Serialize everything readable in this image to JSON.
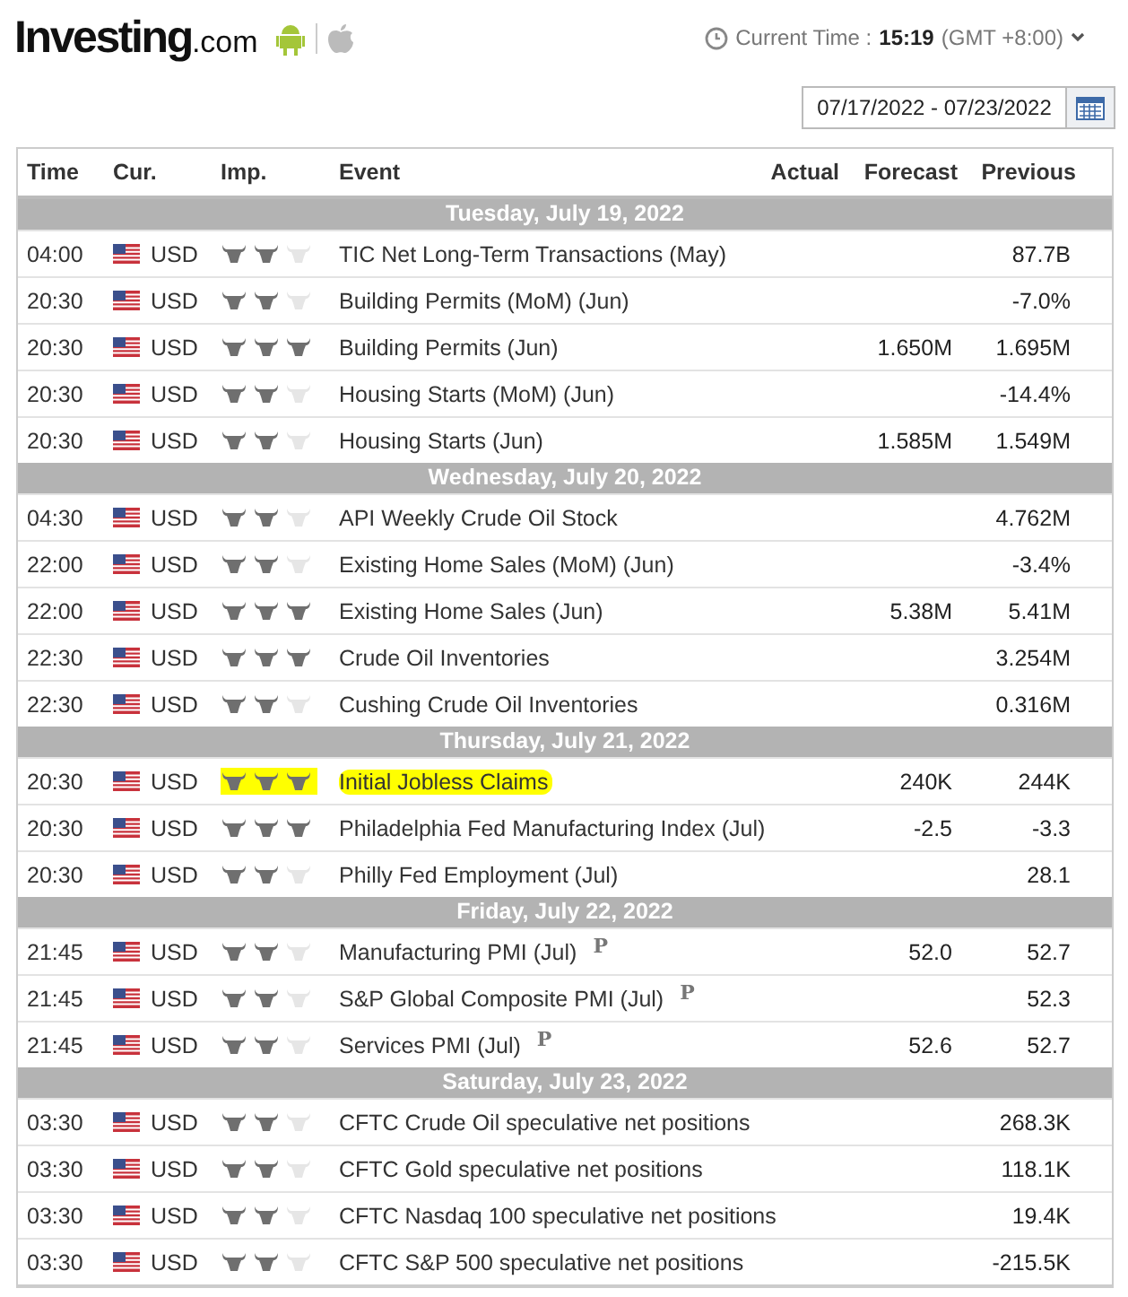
{
  "header": {
    "logo": "Investing",
    "logo_suffix": ".com",
    "current_time_label": "Current Time :",
    "current_time": "15:19",
    "timezone": "(GMT +8:00)"
  },
  "date_range": {
    "value": "07/17/2022 - 07/23/2022"
  },
  "table": {
    "columns": [
      "Time",
      "Cur.",
      "Imp.",
      "Event",
      "Actual",
      "Forecast",
      "Previous"
    ],
    "days": [
      {
        "label": "Tuesday, July 19, 2022",
        "rows": [
          {
            "time": "04:00",
            "currency": "USD",
            "stars": 2,
            "event": "TIC Net Long-Term Transactions (May)",
            "actual": "",
            "forecast": "",
            "previous": "87.7B",
            "highlighted": false
          },
          {
            "time": "20:30",
            "currency": "USD",
            "stars": 2,
            "event": "Building Permits (MoM) (Jun)",
            "actual": "",
            "forecast": "",
            "previous": "-7.0%",
            "highlighted": false
          },
          {
            "time": "20:30",
            "currency": "USD",
            "stars": 3,
            "event": "Building Permits (Jun)",
            "actual": "",
            "forecast": "1.650M",
            "previous": "1.695M",
            "highlighted": false
          },
          {
            "time": "20:30",
            "currency": "USD",
            "stars": 2,
            "event": "Housing Starts (MoM) (Jun)",
            "actual": "",
            "forecast": "",
            "previous": "-14.4%",
            "highlighted": false
          },
          {
            "time": "20:30",
            "currency": "USD",
            "stars": 2,
            "event": "Housing Starts (Jun)",
            "actual": "",
            "forecast": "1.585M",
            "previous": "1.549M",
            "highlighted": false
          }
        ]
      },
      {
        "label": "Wednesday, July 20, 2022",
        "rows": [
          {
            "time": "04:30",
            "currency": "USD",
            "stars": 2,
            "event": "API Weekly Crude Oil Stock",
            "actual": "",
            "forecast": "",
            "previous": "4.762M",
            "highlighted": false
          },
          {
            "time": "22:00",
            "currency": "USD",
            "stars": 2,
            "event": "Existing Home Sales (MoM) (Jun)",
            "actual": "",
            "forecast": "",
            "previous": "-3.4%",
            "highlighted": false
          },
          {
            "time": "22:00",
            "currency": "USD",
            "stars": 3,
            "event": "Existing Home Sales (Jun)",
            "actual": "",
            "forecast": "5.38M",
            "previous": "5.41M",
            "highlighted": false
          },
          {
            "time": "22:30",
            "currency": "USD",
            "stars": 3,
            "event": "Crude Oil Inventories",
            "actual": "",
            "forecast": "",
            "previous": "3.254M",
            "highlighted": false
          },
          {
            "time": "22:30",
            "currency": "USD",
            "stars": 2,
            "event": "Cushing Crude Oil Inventories",
            "actual": "",
            "forecast": "",
            "previous": "0.316M",
            "highlighted": false
          }
        ]
      },
      {
        "label": "Thursday, July 21, 2022",
        "rows": [
          {
            "time": "20:30",
            "currency": "USD",
            "stars": 3,
            "event": "Initial Jobless Claims",
            "actual": "",
            "forecast": "240K",
            "previous": "244K",
            "highlighted": true
          },
          {
            "time": "20:30",
            "currency": "USD",
            "stars": 3,
            "event": "Philadelphia Fed Manufacturing Index (Jul)",
            "actual": "",
            "forecast": "-2.5",
            "previous": "-3.3",
            "highlighted": false
          },
          {
            "time": "20:30",
            "currency": "USD",
            "stars": 2,
            "event": "Philly Fed Employment (Jul)",
            "actual": "",
            "forecast": "",
            "previous": "28.1",
            "highlighted": false
          }
        ]
      },
      {
        "label": "Friday, July 22, 2022",
        "rows": [
          {
            "time": "21:45",
            "currency": "USD",
            "stars": 2,
            "event": "Manufacturing PMI (Jul)",
            "mark": "P",
            "actual": "",
            "forecast": "52.0",
            "previous": "52.7",
            "highlighted": false
          },
          {
            "time": "21:45",
            "currency": "USD",
            "stars": 2,
            "event": "S&P Global Composite PMI (Jul)",
            "mark": "P",
            "actual": "",
            "forecast": "",
            "previous": "52.3",
            "highlighted": false
          },
          {
            "time": "21:45",
            "currency": "USD",
            "stars": 2,
            "event": "Services PMI (Jul)",
            "mark": "P",
            "actual": "",
            "forecast": "52.6",
            "previous": "52.7",
            "highlighted": false
          }
        ]
      },
      {
        "label": "Saturday, July 23, 2022",
        "rows": [
          {
            "time": "03:30",
            "currency": "USD",
            "stars": 2,
            "event": "CFTC Crude Oil speculative net positions",
            "actual": "",
            "forecast": "",
            "previous": "268.3K",
            "highlighted": false
          },
          {
            "time": "03:30",
            "currency": "USD",
            "stars": 2,
            "event": "CFTC Gold speculative net positions",
            "actual": "",
            "forecast": "",
            "previous": "118.1K",
            "highlighted": false
          },
          {
            "time": "03:30",
            "currency": "USD",
            "stars": 2,
            "event": "CFTC Nasdaq 100 speculative net positions",
            "actual": "",
            "forecast": "",
            "previous": "19.4K",
            "highlighted": false
          },
          {
            "time": "03:30",
            "currency": "USD",
            "stars": 2,
            "event": "CFTC S&P 500 speculative net positions",
            "actual": "",
            "forecast": "",
            "previous": "-215.5K",
            "highlighted": false
          }
        ]
      }
    ]
  }
}
